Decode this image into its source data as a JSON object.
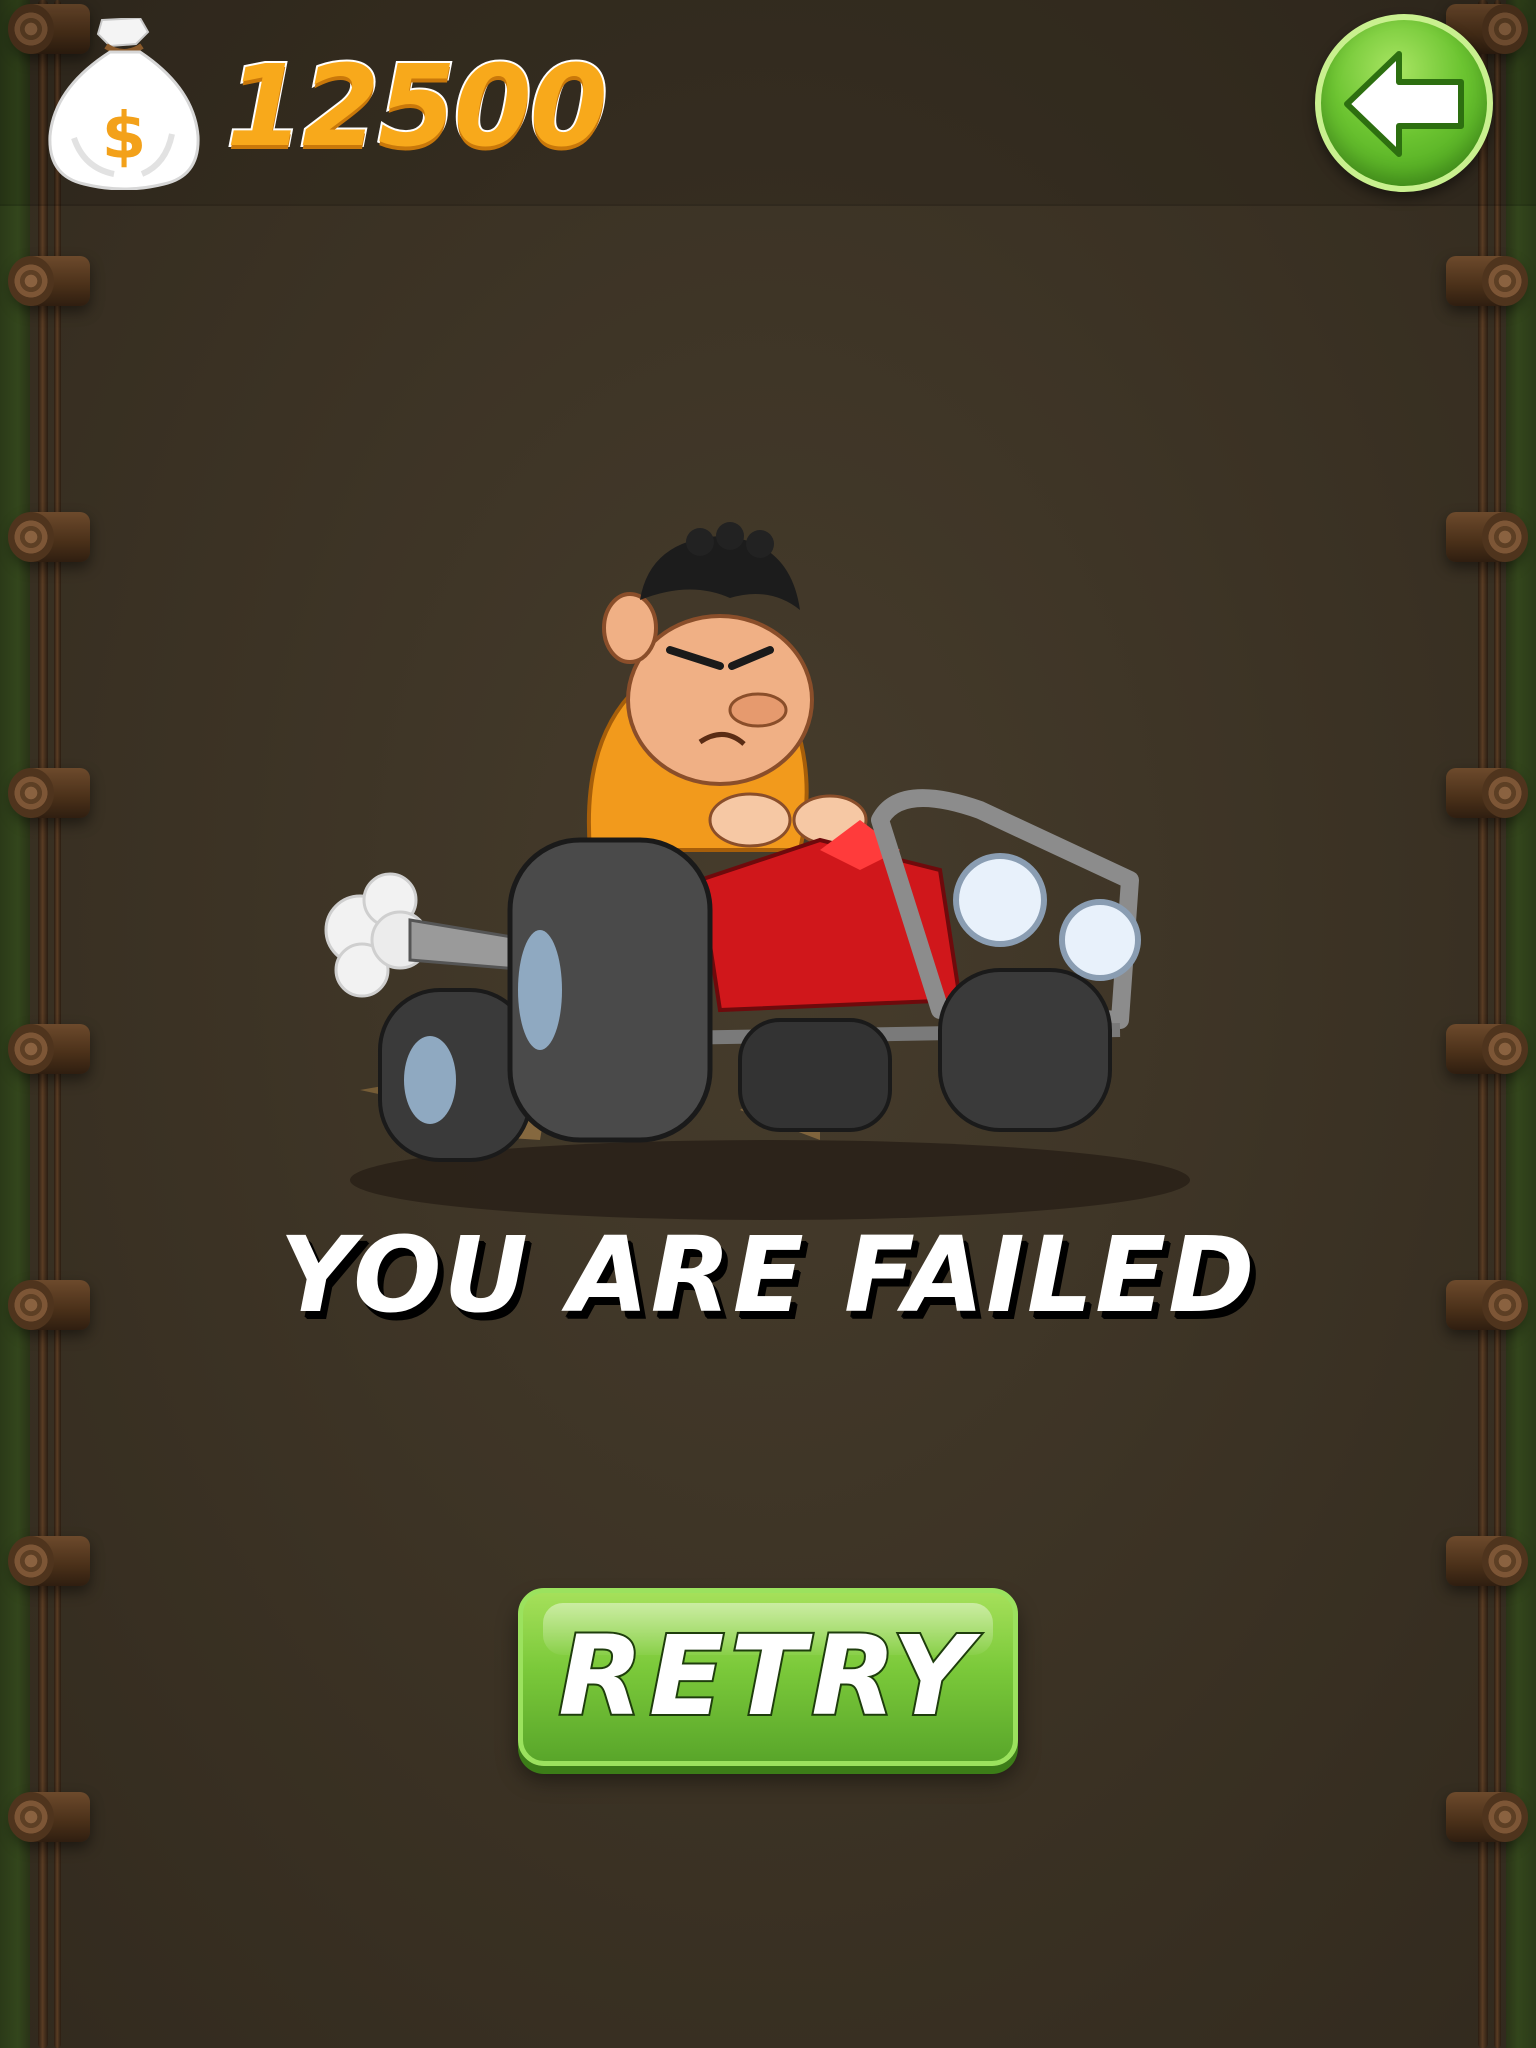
{
  "hud": {
    "coins": "12500",
    "coin_icon": "money-bag-icon",
    "back_icon": "back-arrow-icon"
  },
  "result": {
    "message": "YOU ARE FAILED",
    "character": "driver-in-red-kart"
  },
  "actions": {
    "retry_label": "RETRY"
  },
  "colors": {
    "background": "#3d3425",
    "score": "#f8a91b",
    "button_green": "#7bc93a",
    "kart_red": "#d0171b",
    "shirt_orange": "#f29a1c"
  }
}
